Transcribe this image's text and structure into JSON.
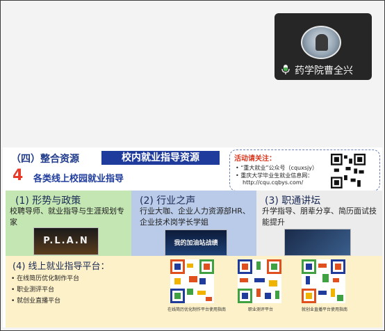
{
  "participant": {
    "name": "药学院曹全兴",
    "mic_icon": "microphone-icon"
  },
  "slide": {
    "section_label": "（四）整合资源",
    "section_tag": "校内就业指导资源",
    "numeral": "4",
    "subtitle": "各类线上校园就业指导",
    "notice": {
      "heading": "活动请关注：",
      "lines": [
        "• “重大就业”公众号（cquxsjy）",
        "• 重庆大学毕业生就业信息网：",
        "http://cqu.cqbys.com/"
      ]
    },
    "panels": [
      {
        "heading": "(1) 形势与政策",
        "body": "校聘导师、就业指导与生涯规划专家",
        "thumb_text": "P.L.A.N"
      },
      {
        "heading": "(2) 行业之声",
        "body": "行业大咖、企业人力资源部HR、企业技术岗学长学姐",
        "thumb_text": "我的加油站战绩"
      },
      {
        "heading": "(3) 职通讲坛",
        "body": "升学指导、朋辈分享、简历面试技能提升",
        "thumb_text": ""
      }
    ],
    "platform": {
      "heading": "(4) 线上就业指导平台：",
      "items": [
        "在线简历优化制作平台",
        "职业测评平台",
        "就创业直播平台"
      ],
      "qr_captions": [
        "在线简历优化制作平台使用指南",
        "职业测评平台",
        "就创业直播平台使用指南"
      ]
    }
  },
  "colors": {
    "accent_blue": "#1f3c9c",
    "accent_red": "#e63b2a",
    "panel_green": "#c4e6b3",
    "panel_blue": "#b9cbe8",
    "panel_grey": "#ececec",
    "platform_bg": "#fdf1c9"
  }
}
